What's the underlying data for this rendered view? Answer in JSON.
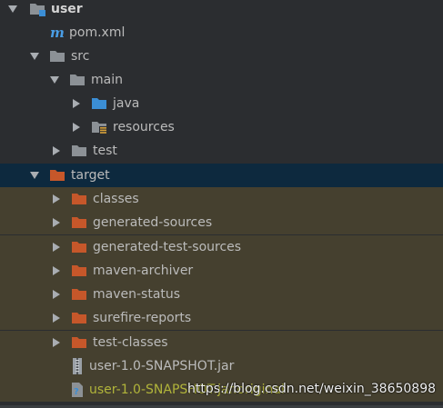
{
  "colors": {
    "background": "#2b2d30",
    "selected_row": "#0d293e",
    "excluded_row": "#45402f",
    "folder_gray": "#8c9196",
    "folder_blue": "#3b8ed5",
    "folder_orange": "#c6572a",
    "text": "#bbbbbb",
    "ignored_text": "#b1b43a"
  },
  "tree": {
    "root": {
      "label": "user",
      "icon": "module-folder-icon"
    },
    "pom": {
      "label": "pom.xml",
      "icon": "maven-m-icon"
    },
    "src": {
      "label": "src",
      "icon": "folder-icon"
    },
    "main": {
      "label": "main",
      "icon": "folder-icon"
    },
    "java": {
      "label": "java",
      "icon": "source-folder-icon"
    },
    "resources": {
      "label": "resources",
      "icon": "resources-folder-icon"
    },
    "test": {
      "label": "test",
      "icon": "folder-icon"
    },
    "target": {
      "label": "target",
      "icon": "excluded-folder-icon"
    },
    "classes": {
      "label": "classes",
      "icon": "excluded-folder-icon"
    },
    "generated_sources": {
      "label": "generated-sources",
      "icon": "excluded-folder-icon"
    },
    "generated_test_sources": {
      "label": "generated-test-sources",
      "icon": "excluded-folder-icon"
    },
    "maven_archiver": {
      "label": "maven-archiver",
      "icon": "excluded-folder-icon"
    },
    "maven_status": {
      "label": "maven-status",
      "icon": "excluded-folder-icon"
    },
    "surefire_reports": {
      "label": "surefire-reports",
      "icon": "excluded-folder-icon"
    },
    "test_classes": {
      "label": "test-classes",
      "icon": "excluded-folder-icon"
    },
    "jar": {
      "label": "user-1.0-SNAPSHOT.jar",
      "icon": "jar-archive-icon"
    },
    "jar_original": {
      "label": "user-1.0-SNAPSHOT.jar.original",
      "icon": "unknown-file-icon"
    }
  },
  "watermark": {
    "text": "https://blog.csdn.net/weixin_38650898"
  }
}
